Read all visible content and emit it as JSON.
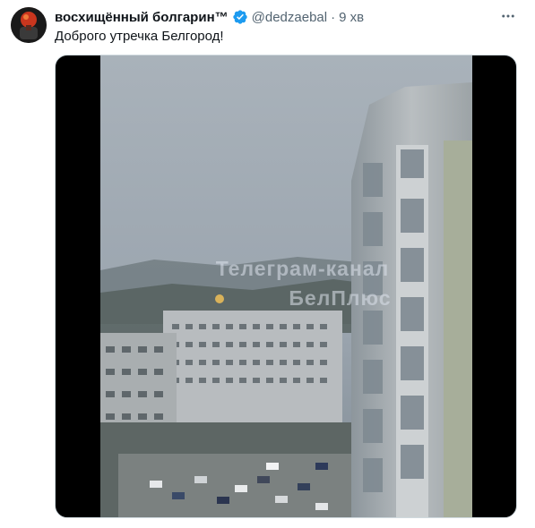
{
  "tweet": {
    "display_name": "восхищённый болгарин™",
    "handle": "@dedzaebal",
    "separator": "·",
    "time": "9 хв",
    "text": "Доброго утречка Белгород!",
    "verified_color": "#1d9bf0",
    "more_icon": "ellipsis-icon"
  },
  "video": {
    "watermark_line1": "Телеграм-канал",
    "watermark_line2": "БелПлюс"
  }
}
